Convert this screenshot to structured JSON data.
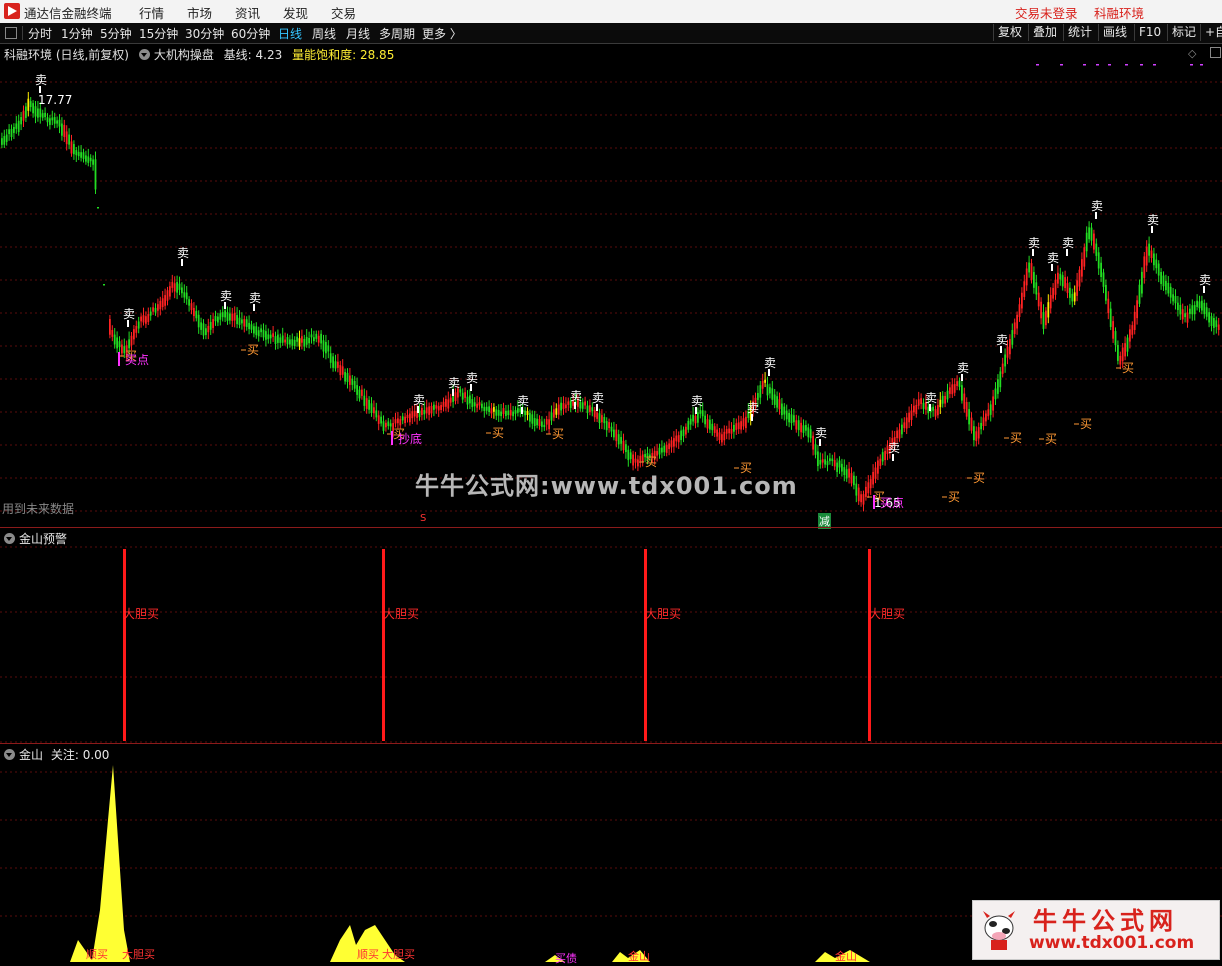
{
  "menubar": {
    "app_title": "通达信金融终端",
    "menus": [
      "行情",
      "市场",
      "资讯",
      "发现",
      "交易"
    ],
    "trade_status": "交易未登录",
    "env_label": "科融环境"
  },
  "toolbar": {
    "periods": [
      "分时",
      "1分钟",
      "5分钟",
      "15分钟",
      "30分钟",
      "60分钟",
      "日线",
      "周线",
      "月线",
      "多周期",
      "更多 〉"
    ],
    "active_period": "日线",
    "right_buttons": [
      "复权",
      "叠加",
      "统计",
      "画线",
      "F10",
      "标记",
      "+自"
    ]
  },
  "main_panel": {
    "stock_label": "科融环境 (日线,前复权)",
    "indicator_name": "大机构操盘",
    "baseline_label": "基线:",
    "baseline_value": "4.23",
    "saturation_label": "量能饱和度:",
    "saturation_value": "28.85",
    "high_price": "17.77",
    "low_price": "1.65",
    "future_data_note": "用到未来数据",
    "sell_label": "卖",
    "buy_label": "买",
    "bottom_marker_s": "S",
    "bottom_marker_reduce": "减",
    "buy_point_label": "买点",
    "bottom_fish_label": "抄底",
    "colors": {
      "up": "#ff2222",
      "down": "#22dd22",
      "hold": "#ffee00",
      "sell": "#ffffff",
      "buy": "#ff9933"
    }
  },
  "warning_panel": {
    "title": "金山预警",
    "signal_label": "大胆买",
    "signal_color": "#ff1a1a"
  },
  "volume_panel": {
    "title": "金山",
    "focus_label": "关注:",
    "focus_value": "0.00",
    "labels": [
      "顺买",
      "大胆买",
      "买债",
      "金山",
      "金山"
    ],
    "fill_color": "#ffff33"
  },
  "watermark": {
    "text": "牛牛公式网:www.tdx001.com",
    "promo_title": "牛牛公式网",
    "promo_url": "www.tdx001.com"
  }
}
